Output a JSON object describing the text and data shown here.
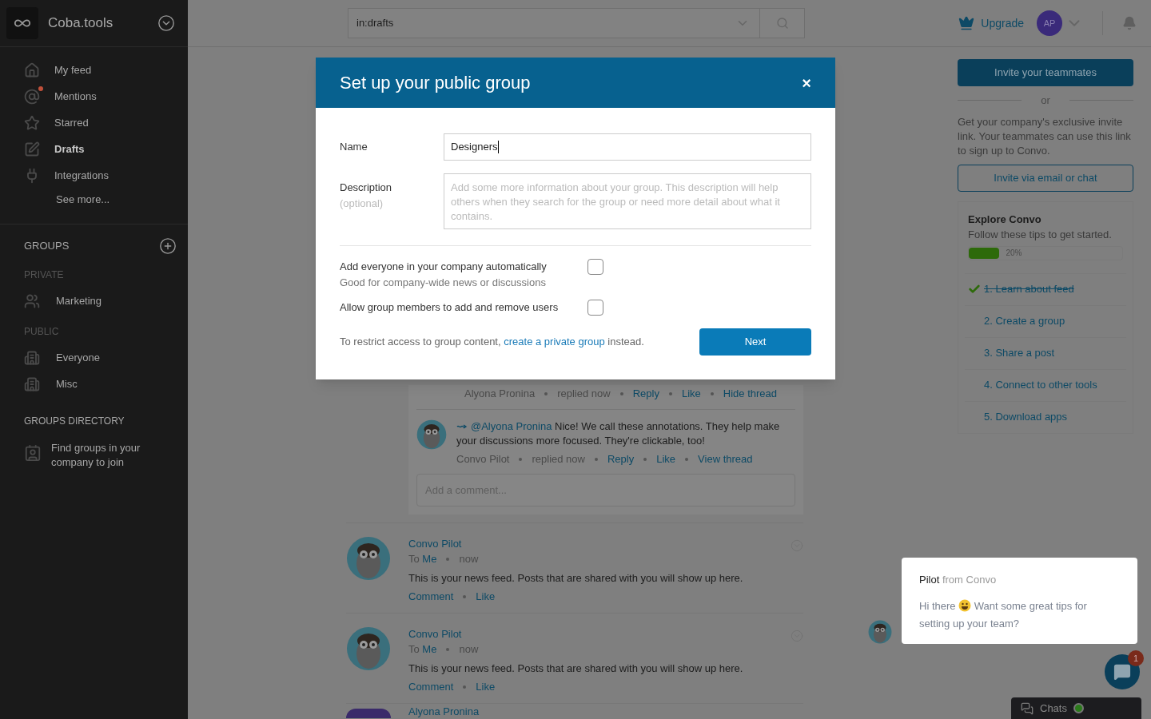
{
  "sidebar": {
    "brand": "Coba.tools",
    "nav": [
      {
        "kind": "home",
        "label": "My feed",
        "selected": false,
        "unread": false
      },
      {
        "kind": "mention",
        "label": "Mentions",
        "selected": false,
        "unread": true
      },
      {
        "kind": "star",
        "label": "Starred",
        "selected": false,
        "unread": false
      },
      {
        "kind": "draft",
        "label": "Drafts",
        "selected": true,
        "unread": false
      },
      {
        "kind": "plug",
        "label": "Integrations",
        "selected": false,
        "unread": false
      }
    ],
    "see_more": "See more...",
    "groups_header": "GROUPS",
    "sections": [
      {
        "kind": "private",
        "title": "PRIVATE",
        "items": [
          "Marketing"
        ]
      },
      {
        "kind": "public",
        "title": "PUBLIC",
        "items": [
          "Everyone",
          "Misc"
        ]
      }
    ],
    "directory": {
      "title": "GROUPS DIRECTORY",
      "item": "Find groups in your company to join"
    }
  },
  "topbar": {
    "search": "in:drafts",
    "upgrade": "Upgrade",
    "avatar": "AP"
  },
  "feed": {
    "thread": {
      "meta": [
        "Alyona Pronina",
        "replied now"
      ],
      "actions": [
        "Reply",
        "Like",
        "Hide thread"
      ],
      "comment": {
        "mention": "@Alyona Pronina",
        "text": "Nice! We call these annotations. They help make your discussions more focused. They're clickable, too!",
        "meta": [
          "Convo Pilot",
          "replied now"
        ],
        "actions": [
          "Reply",
          "Like",
          "View thread"
        ]
      },
      "comment_placeholder": "Add a comment..."
    },
    "posts": [
      {
        "author": "Convo Pilot",
        "to": "To",
        "recipient": "Me",
        "time": "now",
        "text": "This is your news feed. Posts that are shared with you will show up here.",
        "actions": [
          "Comment",
          "Like"
        ]
      },
      {
        "author": "Convo Pilot",
        "to": "To",
        "recipient": "Me",
        "time": "now",
        "text": "This is your news feed. Posts that are shared with you will show up here.",
        "actions": [
          "Comment",
          "Like"
        ]
      }
    ],
    "partial_author": "Alyona Pronina"
  },
  "right": {
    "invite": "Invite your teammates",
    "or": "or",
    "invite_text": "Get your company's exclusive invite link. Your teammates can use this link to sign up to Convo.",
    "invite_link": "Invite via email or chat",
    "explore": {
      "title": "Explore Convo",
      "subtitle": "Follow these tips to get started.",
      "level": 0.2,
      "percent": "20%",
      "steps": [
        {
          "label": "1. Learn about feed",
          "done": true
        },
        {
          "label": "2. Create a group",
          "done": false
        },
        {
          "label": "3. Share a post",
          "done": false
        },
        {
          "label": "4. Connect to other tools",
          "done": false
        },
        {
          "label": "5. Download apps",
          "done": false
        }
      ]
    }
  },
  "modal": {
    "title": "Set up your public group",
    "close": "×",
    "name_label": "Name",
    "name_value": "Designers",
    "description_label": "Description",
    "description_hint": "(optional)",
    "description_placeholder": "Add some more information about your group. This description will help others when they search for the group or need more detail about what it contains.",
    "options": [
      {
        "label": "Add everyone in your company automatically",
        "hint": "Good for company-wide news or discussions",
        "checked": false
      },
      {
        "label": "Allow group members to add and remove users",
        "checked": false
      }
    ],
    "footer": {
      "before": "To restrict access to group content,",
      "link": "create a private group",
      "after": "instead."
    },
    "next": "Next"
  },
  "chat": {
    "sender": "Pilot",
    "from": "from Convo",
    "message_start": "Hi there",
    "message_end": "Want some great tips for setting up your team?",
    "badge": "1",
    "chats": "Chats",
    "online": true
  }
}
